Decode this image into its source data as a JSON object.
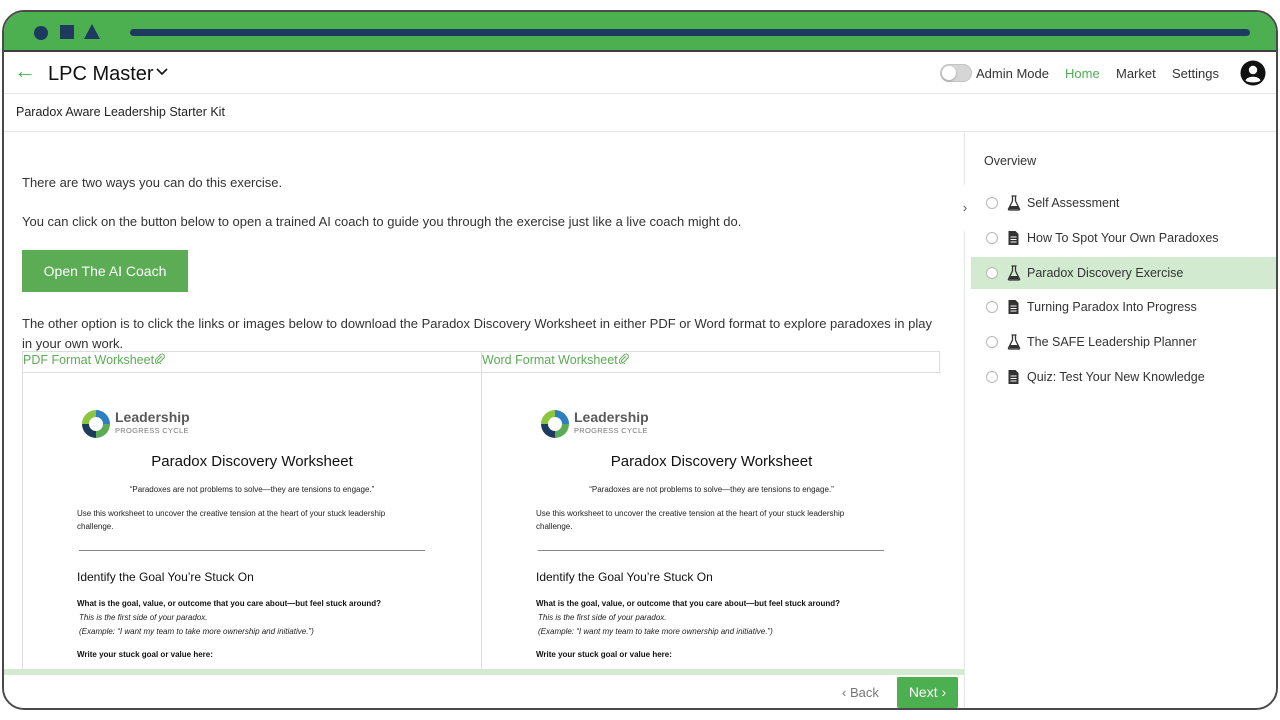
{
  "app": {
    "title": "LPC Master",
    "admin_mode_label": "Admin Mode",
    "nav": {
      "home": "Home",
      "market": "Market",
      "settings": "Settings"
    }
  },
  "colors": {
    "accent": "#4caf50",
    "titlebar": "#4caf50",
    "titlebar_marks": "#1f3a5f"
  },
  "course_title": "Paradox Aware Leadership Starter Kit",
  "content": {
    "paragraph_1": "There are two ways you can do this exercise.",
    "paragraph_2": "You can click on the button below to open a trained AI coach to guide you through the exercise just like a live coach might do.",
    "coach_button": "Open The AI Coach",
    "paragraph_3": "The other option is to click the links or images below to download the Paradox Discovery Worksheet in either PDF or Word format to explore paradoxes in play in your own work.",
    "worksheets": [
      {
        "link_label": "PDF Format Worksheet",
        "link_icon": "paperclip-icon"
      },
      {
        "link_label": "Word Format Worksheet",
        "link_icon": "paperclip-icon"
      }
    ],
    "worksheet_preview": {
      "logo_title": "Leadership",
      "logo_subtitle": "PROGRESS CYCLE",
      "title": "Paradox Discovery Worksheet",
      "quote": "“Paradoxes are not problems to solve—they are tensions to engage.”",
      "instructions": "Use this worksheet to uncover the creative tension at the heart of your stuck leadership challenge.",
      "heading": "Identify the Goal You’re Stuck On",
      "question": "What is the goal, value, or outcome that you care about—but feel stuck around?",
      "note_1": "This is the first side of your paradox.",
      "note_2": "(Example: “I want my team to take more ownership and initiative.”)",
      "write_prompt": "Write your stuck goal or value here:"
    }
  },
  "footer": {
    "back_label": "Back",
    "next_label": "Next"
  },
  "sidebar": {
    "overview_label": "Overview",
    "items": [
      {
        "label": "Self Assessment",
        "icon": "flask-icon",
        "active": false
      },
      {
        "label": "How To Spot Your Own Paradoxes",
        "icon": "document-icon",
        "active": false
      },
      {
        "label": "Paradox Discovery Exercise",
        "icon": "flask-icon",
        "active": true
      },
      {
        "label": "Turning Paradox Into Progress",
        "icon": "document-icon",
        "active": false
      },
      {
        "label": "The SAFE Leadership Planner",
        "icon": "flask-icon",
        "active": false
      },
      {
        "label": "Quiz: Test Your New Knowledge",
        "icon": "document-icon",
        "active": false
      }
    ]
  }
}
